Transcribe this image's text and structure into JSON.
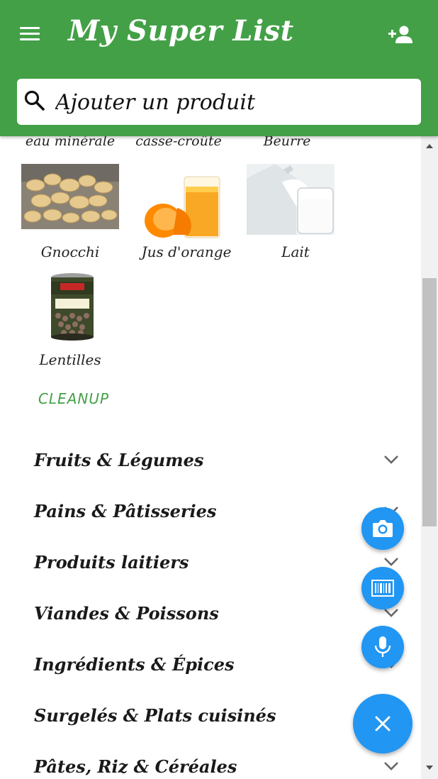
{
  "appbar": {
    "title": "My Super List",
    "menu_icon": "menu-icon",
    "share_icon": "person-add-icon",
    "background": "#43a047"
  },
  "search": {
    "placeholder": "Ajouter un produit",
    "icon": "search-icon"
  },
  "partial_labels": [
    "eau minérale",
    "casse-croûte",
    "Beurre"
  ],
  "products": [
    {
      "label": "Gnocchi",
      "icon": "gnocchi-image"
    },
    {
      "label": "Jus d'orange",
      "icon": "orange-juice-image"
    },
    {
      "label": "Lait",
      "icon": "milk-image"
    },
    {
      "label": "Lentilles",
      "icon": "lentils-can-image"
    }
  ],
  "cleanup_label": "CLEANUP",
  "categories": [
    "Fruits & Légumes",
    "Pains & Pâtisseries",
    "Produits laitiers",
    "Viandes & Poissons",
    "Ingrédients & Épices",
    "Surgelés & Plats cuisinés",
    "Pâtes, Riz & Céréales"
  ],
  "fabs": {
    "camera": "camera-icon",
    "barcode": "barcode-icon",
    "mic": "microphone-icon",
    "close": "close-icon",
    "color": "#2196f3"
  },
  "colors": {
    "accent_green": "#43a047",
    "fab_blue": "#2196f3"
  }
}
